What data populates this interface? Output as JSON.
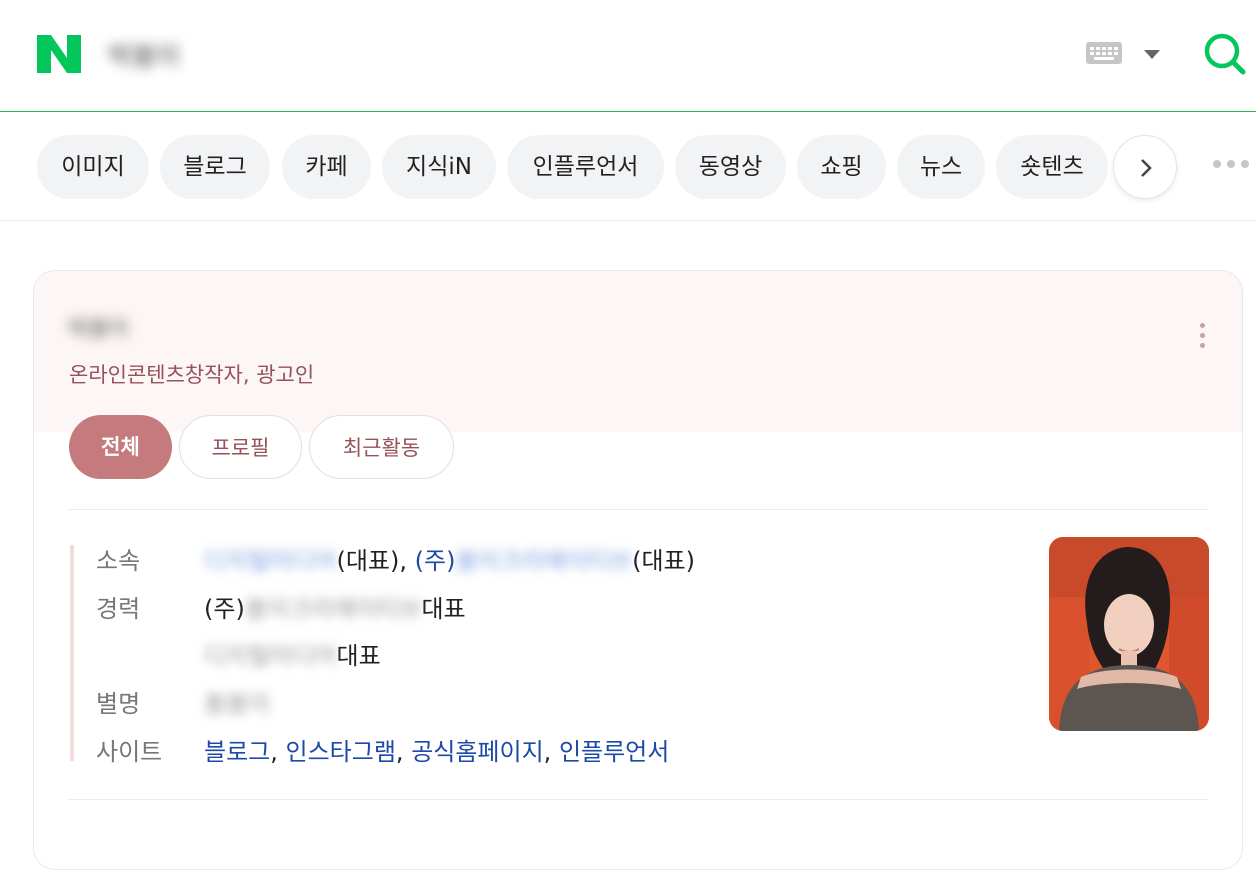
{
  "header": {
    "logo": "N",
    "query": "박봄이",
    "keyboard_icon": "keyboard-icon",
    "search_icon": "search-icon",
    "brand_color": "#03c75a"
  },
  "tabs": [
    {
      "label": "이미지"
    },
    {
      "label": "블로그"
    },
    {
      "label": "카페"
    },
    {
      "label": "지식iN"
    },
    {
      "label": "인플루언서"
    },
    {
      "label": "동영상"
    },
    {
      "label": "쇼핑"
    },
    {
      "label": "뉴스"
    },
    {
      "label": "숏텐츠"
    }
  ],
  "profile": {
    "name": "박봄이",
    "occupation": "온라인콘텐츠창작자, 광고인",
    "pills": [
      "전체",
      "프로필",
      "최근활동"
    ],
    "accent_color": "#c57b7d",
    "rows": {
      "affiliation": {
        "label": "소속",
        "org1": "디지털미디어",
        "suffix1": "(대표), ",
        "prefix2": "(주)",
        "org2": "봄이크리에이티브",
        "suffix2": "(대표)"
      },
      "career": {
        "label": "경력",
        "prefix1": "(주)",
        "org1": "봄이크리에이티브",
        "suffix1": "대표",
        "org2": "디지털미디어",
        "suffix2": "대표"
      },
      "alias": {
        "label": "별명",
        "value": "봄봄이"
      },
      "sites": {
        "label": "사이트",
        "blog": "블로그",
        "instagram": "인스타그램",
        "homepage": "공식홈페이지",
        "influencer": "인플루언서",
        "sep": ", "
      }
    }
  }
}
